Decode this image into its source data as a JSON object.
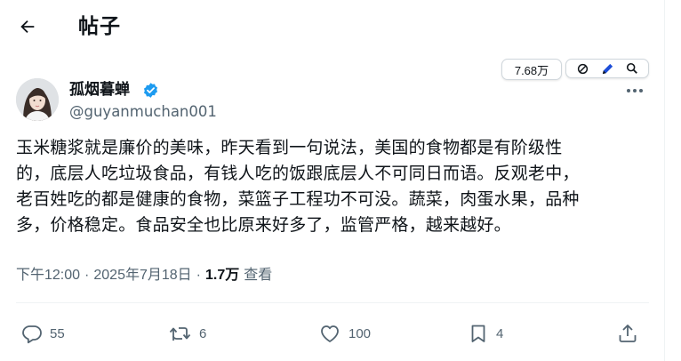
{
  "header": {
    "title": "帖子"
  },
  "toolbar": {
    "views_badge": "7.68万"
  },
  "author": {
    "name": "孤烟暮蝉",
    "handle": "@guyanmuchan001"
  },
  "tweet": {
    "lines": [
      "玉米糖浆就是廉价的美味，昨天看到一句说法，美国的食物都是有阶级性",
      "的，底层人吃垃圾食品，有钱人吃的饭跟底层人不可同日而语。反观老中，",
      "老百姓吃的都是健康的食物，菜篮子工程功不可没。蔬菜，肉蛋水果，品种",
      "多，价格稳定。食品安全也比原来好多了，监管严格，越来越好。"
    ]
  },
  "meta": {
    "time": "下午12:00",
    "separator": "·",
    "date": "2025年7月18日",
    "views": "1.7万",
    "views_label": "查看"
  },
  "actions": {
    "reply_count": "55",
    "retweet_count": "6",
    "like_count": "100",
    "bookmark_count": "4"
  },
  "colors": {
    "verified": "#1d9bf0",
    "secondary_text": "#536471",
    "primary_text": "#0f1419"
  }
}
